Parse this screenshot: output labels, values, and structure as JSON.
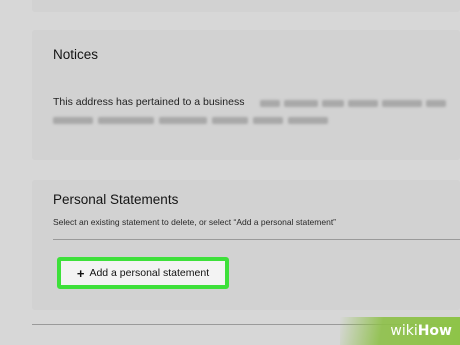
{
  "notices": {
    "title": "Notices",
    "text": "This address has pertained to a business"
  },
  "personal_statements": {
    "title": "Personal Statements",
    "hint": "Select an existing statement to delete, or select “Add a personal statement”",
    "add_button_label": "Add a personal statement",
    "add_button_icon": "plus-icon",
    "highlight_color": "#3de03a"
  },
  "watermark": {
    "wiki": "wiki",
    "how": "How"
  }
}
